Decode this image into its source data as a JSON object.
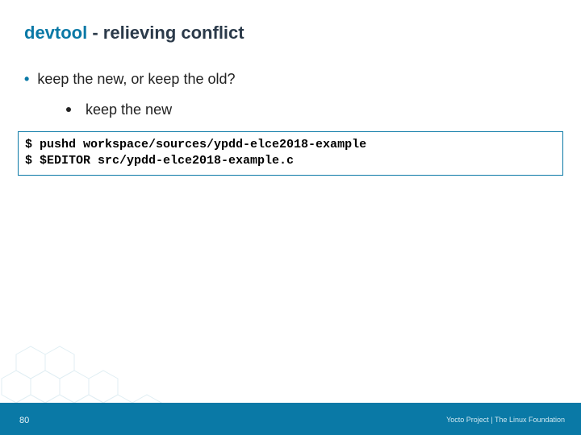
{
  "title_part1": "devtool",
  "title_part2": " - relieving conflict",
  "bullet1": "keep the new, or keep the old?",
  "bullet2": "keep the new",
  "code": "$ pushd workspace/sources/ypdd-elce2018-example\n$ $EDITOR src/ypdd-elce2018-example.c",
  "page_number": "80",
  "footer_credit": "Yocto Project | The Linux Foundation"
}
